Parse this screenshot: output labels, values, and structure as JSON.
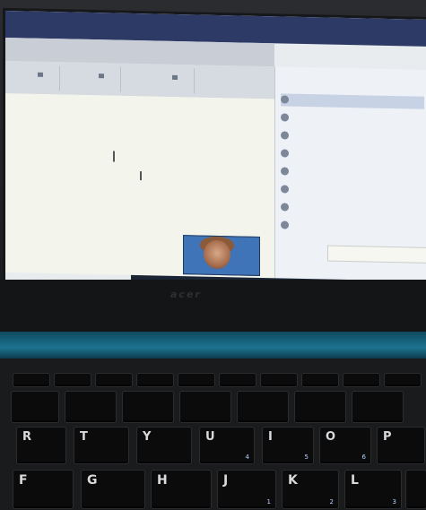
{
  "screen": {
    "app_title": "",
    "doc_heading": "",
    "status_text": "",
    "participants_header": "",
    "participants": [],
    "clock": ""
  },
  "laptop": {
    "brand_logo": "acer"
  },
  "keyboard": {
    "row_qwerty": [
      "R",
      "T",
      "Y",
      "U",
      "I",
      "O",
      "P"
    ],
    "row_home": [
      "F",
      "G",
      "H",
      "J",
      "K",
      "L"
    ],
    "numpad_labels": [
      "4",
      "5",
      "6",
      "1",
      "2",
      "3"
    ]
  },
  "colors": {
    "titlebar": "#2d3a66",
    "doc_heading": "#e0303a",
    "hinge_accent": "#1d7390"
  }
}
